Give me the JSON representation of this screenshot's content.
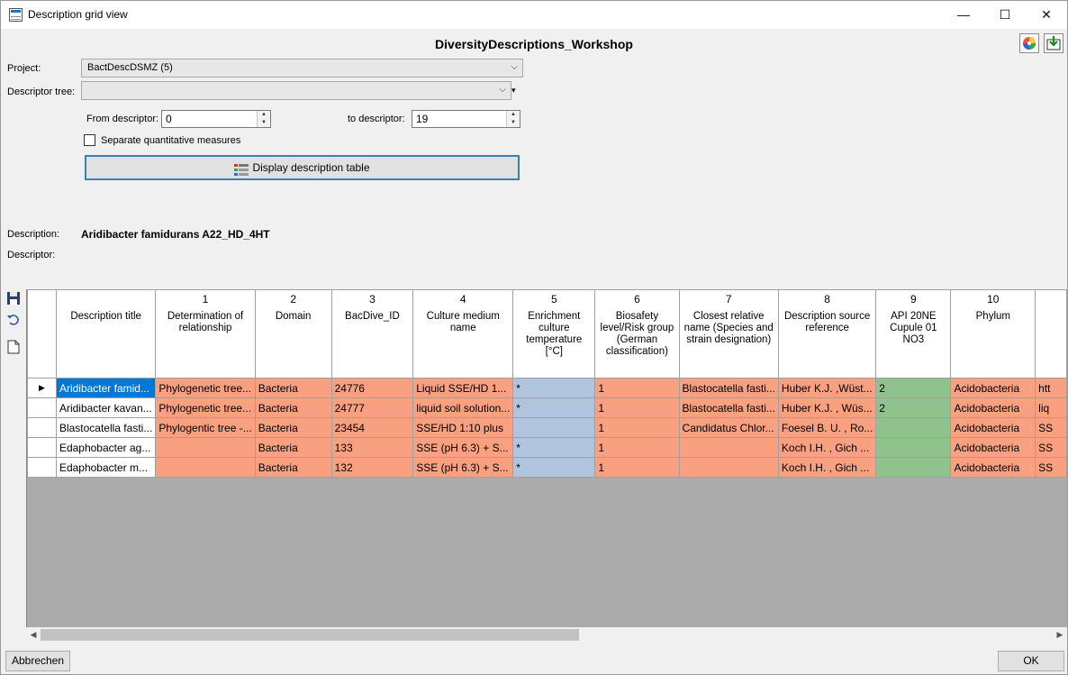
{
  "window": {
    "title": "Description grid view",
    "minimize": "—",
    "maximize": "☐",
    "close": "✕"
  },
  "header": {
    "title": "DiversityDescriptions_Workshop",
    "color_icon": "color-wheel-icon",
    "export_icon": "export-icon"
  },
  "form": {
    "project_label": "Project:",
    "project_value": "BactDescDSMZ (5)",
    "descriptor_tree_label": "Descriptor tree:",
    "descriptor_tree_value": "",
    "from_label": "From descriptor:",
    "from_value": "0",
    "to_label": "to descriptor:",
    "to_value": "19",
    "separate_label": "Separate quantitative measures",
    "separate_checked": false,
    "display_button": "Display description table",
    "description_label": "Description:",
    "description_value": "Aridibacter famidurans A22_HD_4HT",
    "descriptor_label": "Descriptor:",
    "descriptor_value": ""
  },
  "grid": {
    "columns": [
      {
        "num": "",
        "name": "Description title"
      },
      {
        "num": "1",
        "name": "Determination of relationship"
      },
      {
        "num": "2",
        "name": "Domain"
      },
      {
        "num": "3",
        "name": "BacDive_ID"
      },
      {
        "num": "4",
        "name": "Culture medium name"
      },
      {
        "num": "5",
        "name": "Enrichment culture temperature [°C]"
      },
      {
        "num": "6",
        "name": "Biosafety level/Risk group (German classification)"
      },
      {
        "num": "7",
        "name": "Closest relative name (Species and strain designation)"
      },
      {
        "num": "8",
        "name": "Description source reference"
      },
      {
        "num": "9",
        "name": "API 20NE Cupule 01 NO3"
      },
      {
        "num": "10",
        "name": "Phylum"
      },
      {
        "num": "",
        "name": ""
      }
    ],
    "rows": [
      {
        "cells": [
          "Aridibacter famid...",
          "Phylogenetic tree...",
          "Bacteria",
          "24776",
          "Liquid SSE/HD 1...",
          "*",
          "1",
          "Blastocatella fasti...",
          "Huber K.J. ,Wüst...",
          "2",
          "Acidobacteria",
          "htt"
        ]
      },
      {
        "cells": [
          "Aridibacter kavan...",
          "Phylogenetic tree...",
          "Bacteria",
          "24777",
          "liquid soil solution...",
          "*",
          "1",
          "Blastocatella fasti...",
          "Huber K.J. , Wüs...",
          "2",
          "Acidobacteria",
          "liq"
        ]
      },
      {
        "cells": [
          "Blastocatella fasti...",
          "Phylogentic tree -...",
          "Bacteria",
          "23454",
          "SSE/HD 1:10 plus",
          "",
          "1",
          "Candidatus Chlor...",
          "Foesel B. U. , Ro...",
          "",
          "Acidobacteria",
          "SS"
        ]
      },
      {
        "cells": [
          "Edaphobacter ag...",
          "",
          "Bacteria",
          "133",
          "SSE (pH 6.3) + S...",
          "*",
          "1",
          "",
          "Koch I.H. , Gich ...",
          "",
          "Acidobacteria",
          "SS"
        ]
      },
      {
        "cells": [
          "Edaphobacter m...",
          "",
          "Bacteria",
          "132",
          "SSE (pH 6.3) + S...",
          "*",
          "1",
          "",
          "Koch I.H. , Gich ...",
          "",
          "Acidobacteria",
          "SS"
        ]
      }
    ],
    "current_row_marker": "▶"
  },
  "colors": {
    "title": "#ffffff",
    "selected": "#0078d7",
    "orange": "#f8a07f",
    "blue": "#b0c4de",
    "green": "#8fc28d",
    "grid_bg": "#ababab"
  },
  "footer": {
    "cancel_button": "Abbrechen",
    "ok_button": "OK"
  }
}
